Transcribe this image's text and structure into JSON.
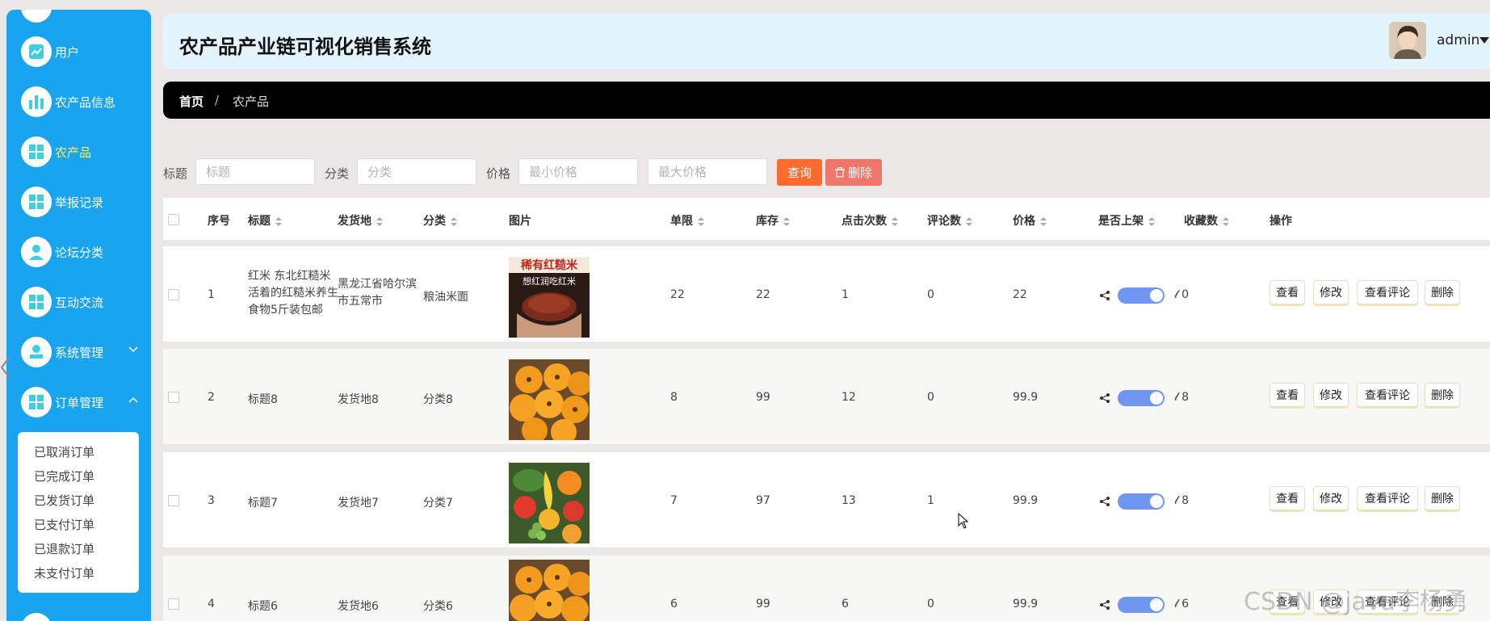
{
  "app": {
    "title": "农产品产业链可视化销售系统"
  },
  "user": {
    "name": "admin"
  },
  "sidebar": {
    "items": [
      {
        "label": "用户",
        "icon": "line-chart-icon"
      },
      {
        "label": "农产品信息",
        "icon": "bar-chart-icon"
      },
      {
        "label": "农产品",
        "icon": "grid-icon"
      },
      {
        "label": "举报记录",
        "icon": "grid-icon"
      },
      {
        "label": "论坛分类",
        "icon": "person-icon"
      },
      {
        "label": "互动交流",
        "icon": "grid-icon"
      },
      {
        "label": "系统管理",
        "icon": "stamp-icon"
      },
      {
        "label": "订单管理",
        "icon": "grid-icon"
      }
    ],
    "active_item": "农产品",
    "submenu": [
      "已取消订单",
      "已完成订单",
      "已发货订单",
      "已支付订单",
      "已退款订单",
      "未支付订单"
    ]
  },
  "breadcrumb": {
    "home": "首页",
    "separator": "/",
    "current": "农产品"
  },
  "filters": {
    "title_label": "标题",
    "title_placeholder": "标题",
    "category_label": "分类",
    "category_placeholder": "分类",
    "price_label": "价格",
    "min_price_placeholder": "最小价格",
    "max_price_placeholder": "最大价格",
    "query_button": "查询",
    "delete_button": "删除"
  },
  "table": {
    "columns": [
      "序号",
      "标题",
      "发货地",
      "分类",
      "图片",
      "单限",
      "库存",
      "点击次数",
      "评论数",
      "价格",
      "是否上架",
      "收藏数",
      "操作"
    ],
    "actions": [
      "查看",
      "修改",
      "查看评论",
      "删除"
    ],
    "rows": [
      {
        "index": "1",
        "title": "红米 东北红糙米活着的红糙米养生食物5斤装包邮",
        "origin": "黑龙江省哈尔滨市五常市",
        "category": "粮油米面",
        "image": "rice",
        "image_text_top": "稀有红糙米",
        "image_text_mid": "想红润吃红米",
        "limit": "22",
        "stock": "22",
        "clicks": "1",
        "comments": "0",
        "price": "22",
        "on_shelf": true,
        "favorites": "0"
      },
      {
        "index": "2",
        "title": "标题8",
        "origin": "发货地8",
        "category": "分类8",
        "image": "loquat",
        "limit": "8",
        "stock": "99",
        "clicks": "12",
        "comments": "0",
        "price": "99.9",
        "on_shelf": true,
        "favorites": "8"
      },
      {
        "index": "3",
        "title": "标题7",
        "origin": "发货地7",
        "category": "分类7",
        "image": "fruits",
        "limit": "7",
        "stock": "97",
        "clicks": "13",
        "comments": "1",
        "price": "99.9",
        "on_shelf": true,
        "favorites": "8"
      },
      {
        "index": "4",
        "title": "标题6",
        "origin": "发货地6",
        "category": "分类6",
        "image": "loquat",
        "limit": "6",
        "stock": "99",
        "clicks": "6",
        "comments": "0",
        "price": "99.9",
        "on_shelf": true,
        "favorites": "6"
      }
    ]
  },
  "watermark": "CSDN @java李杨勇",
  "colors": {
    "sidebar": "#1aa3ef",
    "active": "#ffef5a",
    "query": "#ff6b2b",
    "delete": "#f0756b",
    "toggle": "#6f96f0"
  }
}
